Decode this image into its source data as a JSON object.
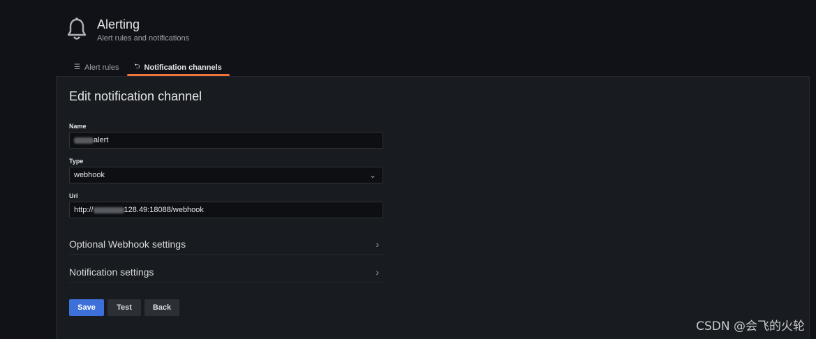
{
  "header": {
    "title": "Alerting",
    "subtitle": "Alert rules and notifications",
    "icon": "bell-icon"
  },
  "tabs": [
    {
      "label": "Alert rules",
      "icon": "list-icon",
      "active": false
    },
    {
      "label": "Notification channels",
      "icon": "channel-icon",
      "active": true
    }
  ],
  "form": {
    "title": "Edit notification channel",
    "name_label": "Name",
    "name_value_visible": "alert",
    "type_label": "Type",
    "type_value": "webhook",
    "url_label": "Url",
    "url_prefix": "http://",
    "url_suffix": "128.49:18088/webhook",
    "optional_section": "Optional Webhook settings",
    "notification_section": "Notification settings"
  },
  "buttons": {
    "save": "Save",
    "test": "Test",
    "back": "Back"
  },
  "watermark": "CSDN @会飞的火轮",
  "colors": {
    "background": "#111217",
    "panel": "#181b1f",
    "accent_tab": "#f0733b",
    "primary_button": "#3d71d9"
  }
}
